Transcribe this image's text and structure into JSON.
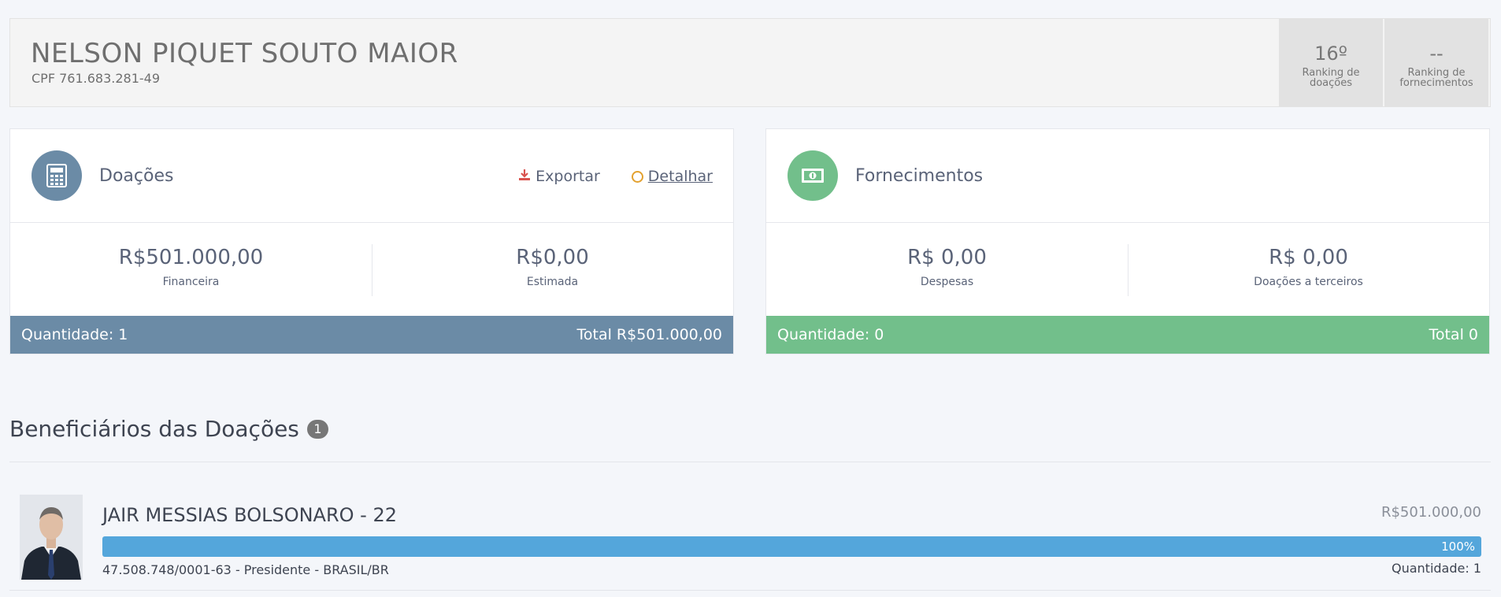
{
  "header": {
    "name": "NELSON PIQUET SOUTO MAIOR",
    "cpf": "CPF 761.683.281-49",
    "rankings": [
      {
        "value": "16º",
        "label": "Ranking de doações"
      },
      {
        "value": "--",
        "label": "Ranking de fornecimentos"
      }
    ]
  },
  "doacoes": {
    "title": "Doações",
    "icon": "calculator-icon",
    "actions": {
      "export": "Exportar",
      "detail": "Detalhar"
    },
    "stats": [
      {
        "value": "R$501.000,00",
        "label": "Financeira"
      },
      {
        "value": "R$0,00",
        "label": "Estimada"
      }
    ],
    "quantity": "Quantidade: 1",
    "total": "Total R$501.000,00",
    "color": "#6b8ba6"
  },
  "fornecimentos": {
    "title": "Fornecimentos",
    "icon": "money-bill-icon",
    "stats": [
      {
        "value": "R$ 0,00",
        "label": "Despesas"
      },
      {
        "value": "R$ 0,00",
        "label": "Doações a terceiros"
      }
    ],
    "quantity": "Quantidade: 0",
    "total": "Total 0",
    "color": "#72bf8b"
  },
  "beneficiarios": {
    "title": "Beneficiários das Doações",
    "count": "1",
    "items": [
      {
        "name": "JAIR MESSIAS BOLSONARO - 22",
        "value": "R$501.000,00",
        "percent": 100,
        "percent_label": "100%",
        "details": "47.508.748/0001-63 - Presidente - BRASIL/BR",
        "quantity": "Quantidade: 1"
      }
    ]
  }
}
